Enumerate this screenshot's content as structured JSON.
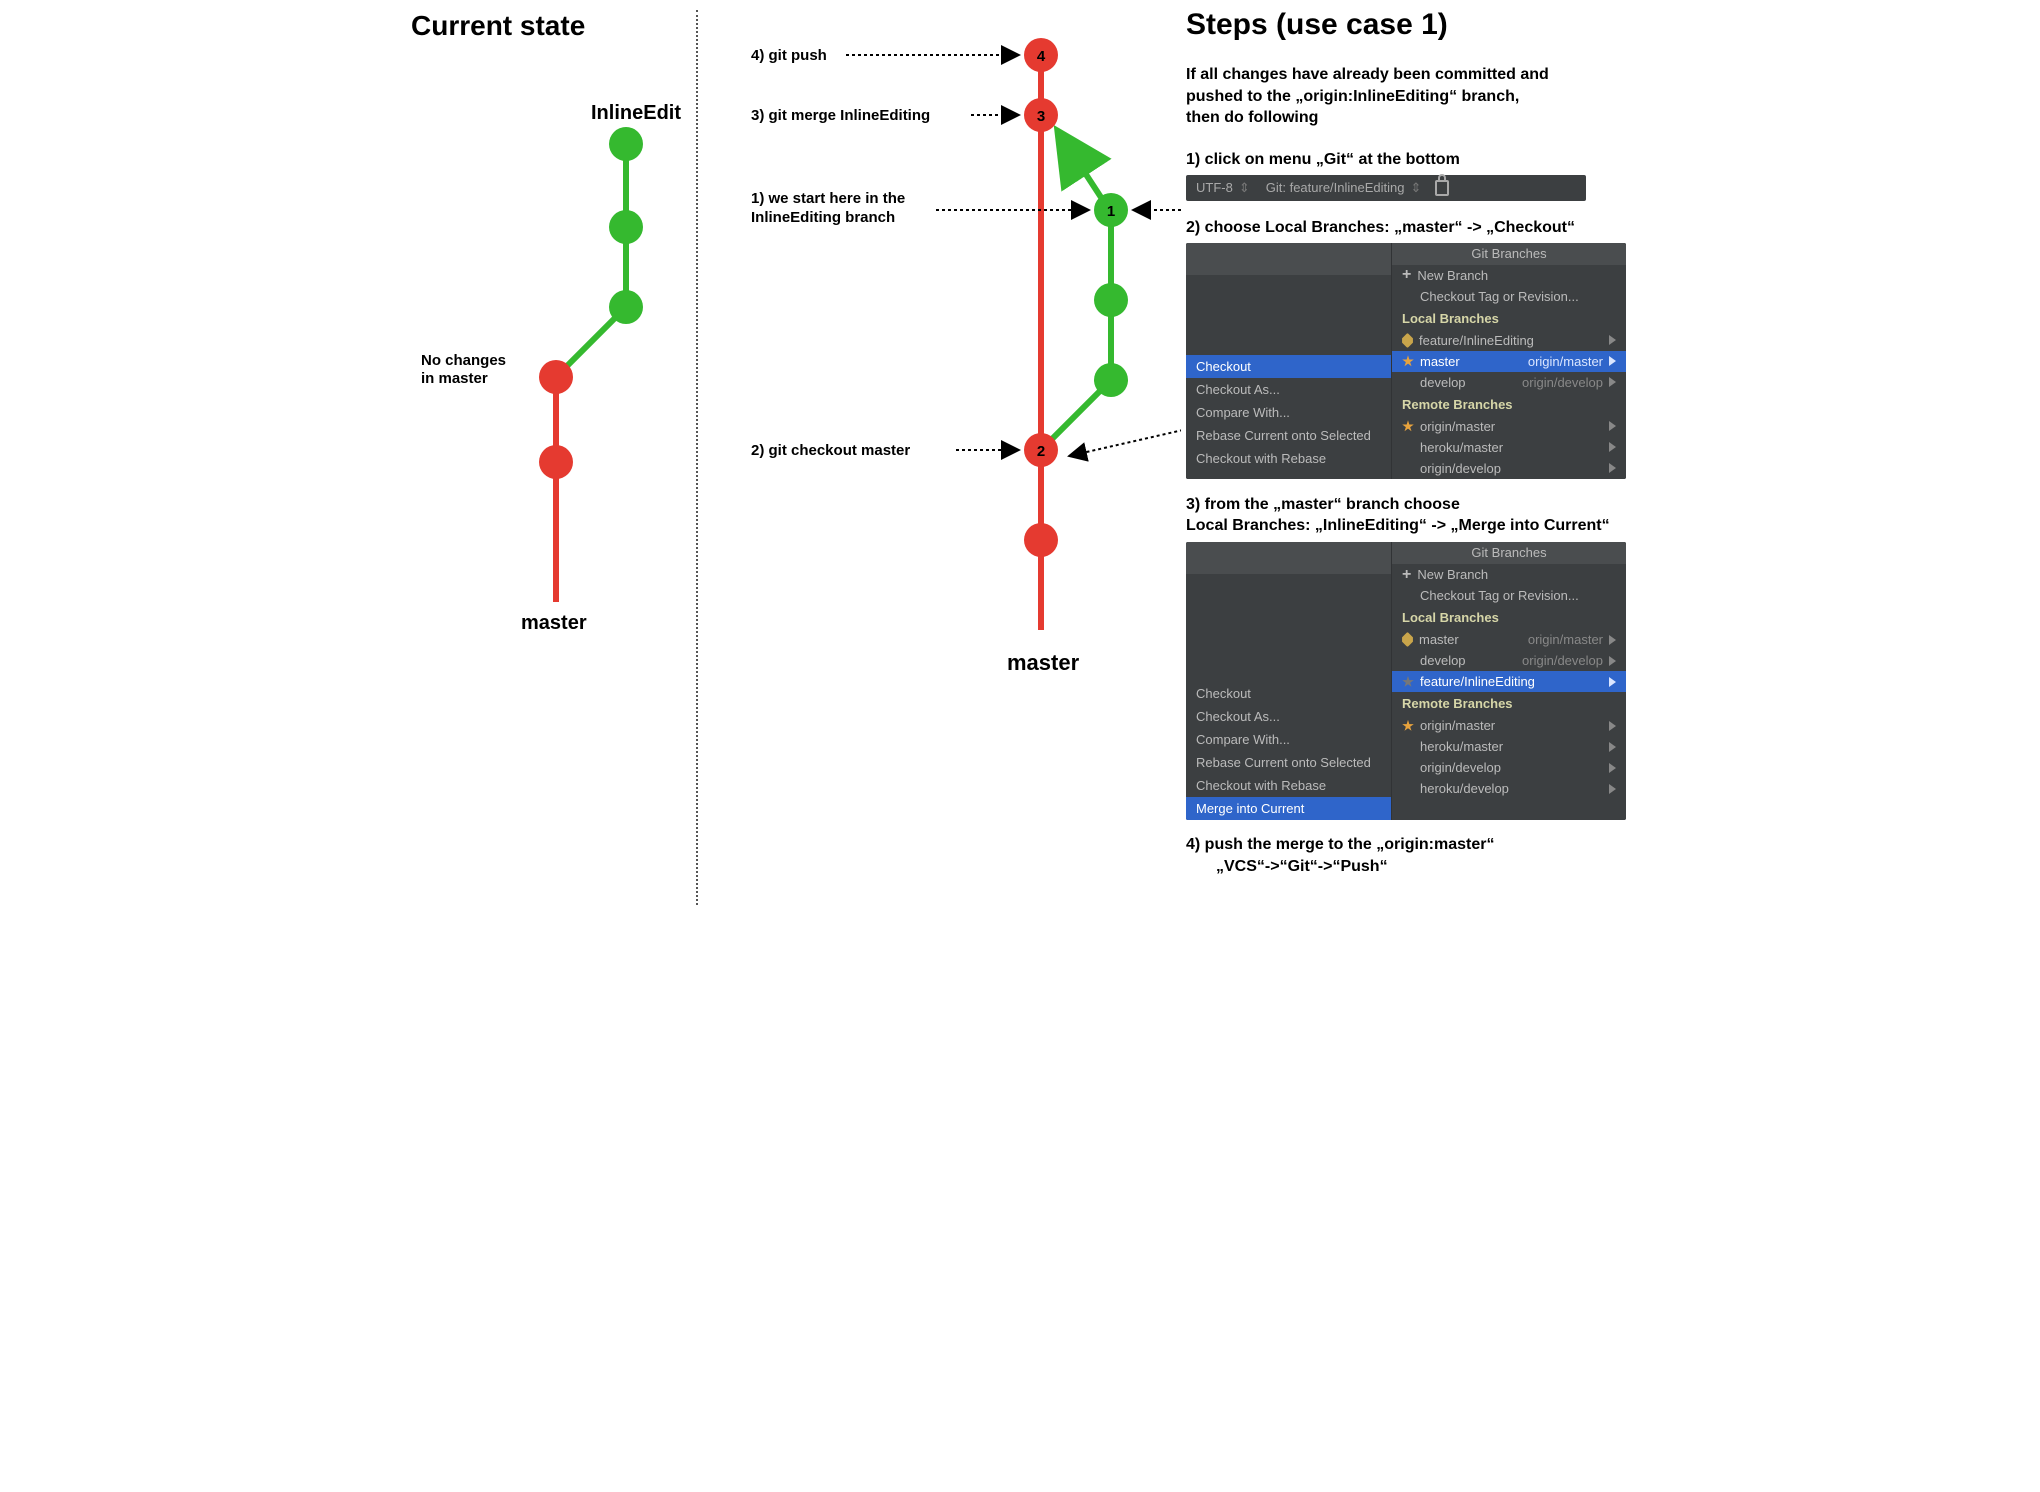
{
  "col1": {
    "heading": "Current state",
    "branch_label_top": "InlineEdit",
    "note_line1": "No changes",
    "note_line2": "in master",
    "branch_label_bottom": "master"
  },
  "col2": {
    "label4": "4) git push",
    "label3": "3) git merge InlineEditing",
    "label1a": "1) we start here in the",
    "label1b": "InlineEditing branch",
    "label2": "2) git checkout master",
    "branch_label": "master"
  },
  "col3": {
    "heading": "Steps (use case 1)",
    "intro1": "If all changes have already been committed and",
    "intro2": "pushed to the „origin:InlineEditing“ branch,",
    "intro3": "then do following",
    "step1": "1) click on menu „Git“ at the bottom",
    "statusbar_enc": "UTF-8",
    "statusbar_git": "Git: feature/InlineEditing",
    "step2": "2) choose Local Branches: „master“ -> „Checkout“",
    "ide_title": "Git Branches",
    "new_branch": "New Branch",
    "checkout_tag": "Checkout Tag or Revision...",
    "local_branches": "Local Branches",
    "remote_branches": "Remote Branches",
    "feature_inline": "feature/InlineEditing",
    "master_label": "master",
    "origin_master": "origin/master",
    "develop_label": "develop",
    "origin_develop": "origin/develop",
    "heroku_master": "heroku/master",
    "heroku_develop": "heroku/develop",
    "left_checkout": "Checkout",
    "left_checkout_as": "Checkout As...",
    "left_compare": "Compare With...",
    "left_rebase_sel": "Rebase Current onto Selected",
    "left_checkout_rebase": "Checkout with Rebase",
    "left_merge": "Merge into Current",
    "step3a": "3) from the „master“ branch choose",
    "step3b": "Local Branches: „InlineEditing“ -> „Merge into Current“",
    "step4a": "4) push the merge to the „origin:master“",
    "step4b": "„VCS“->“Git“->“Push“"
  },
  "chart_data": {
    "type": "git-graph",
    "diagrams": [
      {
        "name": "Current state",
        "branches": [
          {
            "name": "master",
            "color": "#e53a30",
            "commits": 3,
            "note": "No changes in master"
          },
          {
            "name": "InlineEdit",
            "color": "#35b92f",
            "commits": 3,
            "forks_from": "master",
            "fork_at_commit_index": 2
          }
        ]
      },
      {
        "name": "Steps",
        "master_line_color": "#e53a30",
        "feature_line_color": "#35b92f",
        "nodes": [
          {
            "id": "m-base",
            "branch": "master",
            "color": "#e53a30"
          },
          {
            "id": "2",
            "branch": "master",
            "color": "#e53a30",
            "annotation": "2) git checkout master"
          },
          {
            "id": "feature-a",
            "branch": "feature",
            "color": "#35b92f"
          },
          {
            "id": "feature-b",
            "branch": "feature",
            "color": "#35b92f"
          },
          {
            "id": "1",
            "branch": "feature",
            "color": "#35b92f",
            "annotation": "1) we start here in the InlineEditing branch"
          },
          {
            "id": "3",
            "branch": "master",
            "color": "#e53a30",
            "annotation": "3) git merge InlineEditing",
            "merge_from": "1"
          },
          {
            "id": "4",
            "branch": "master",
            "color": "#e53a30",
            "annotation": "4) git push"
          }
        ],
        "bottom_label": "master"
      }
    ]
  }
}
